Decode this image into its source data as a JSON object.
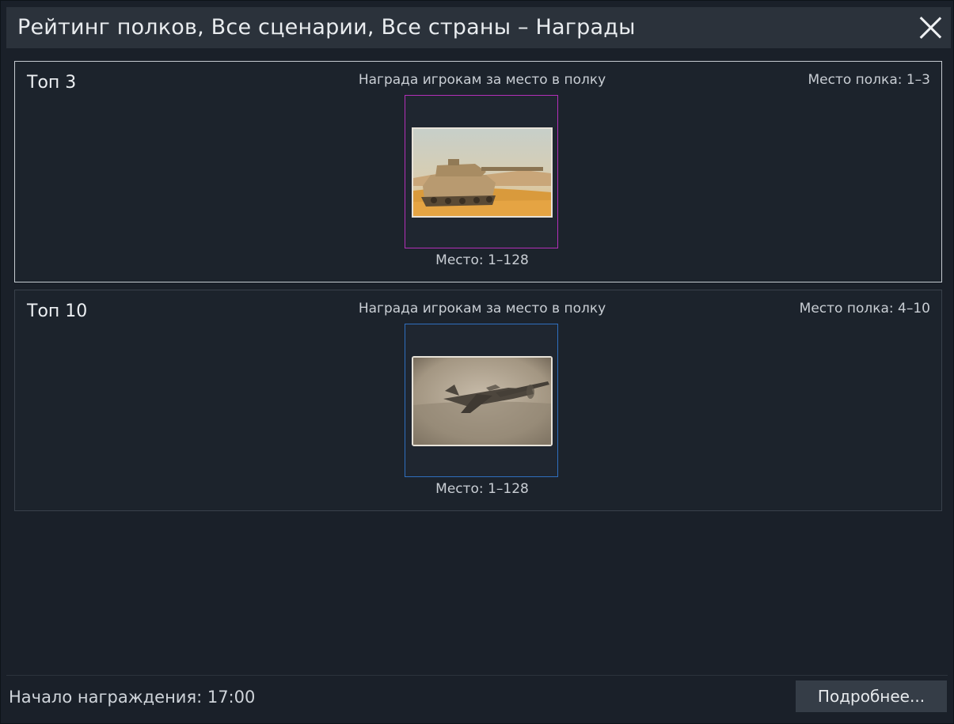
{
  "window": {
    "title": "Рейтинг полков, Все сценарии, Все страны – Награды"
  },
  "rewards": [
    {
      "tier": "Топ 3",
      "caption": "Награда игрокам за место в полку",
      "regiment_place": "Место полка: 1–3",
      "player_place": "Место: 1–128",
      "rarity_color": "#b32fb8",
      "image": "tank-decal"
    },
    {
      "tier": "Топ 10",
      "caption": "Награда игрокам за место в полку",
      "regiment_place": "Место полка: 4–10",
      "player_place": "Место: 1–128",
      "rarity_color": "#2f6fbf",
      "image": "aircraft-decal"
    }
  ],
  "footer": {
    "award_start": "Начало награждения: 17:00",
    "details_button": "Подробнее..."
  }
}
